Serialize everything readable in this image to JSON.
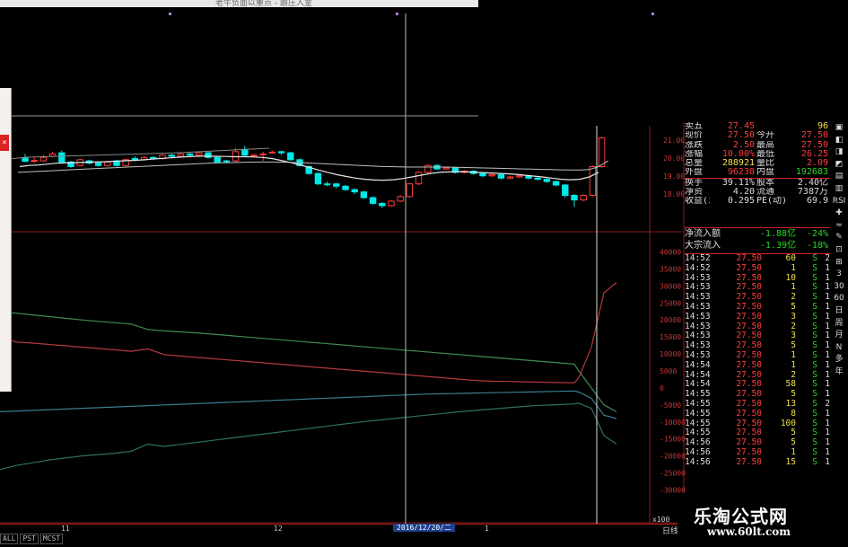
{
  "window": {
    "title": "老牛负面以重点 - 跟庄入室"
  },
  "chart_data": [
    {
      "type": "candlestick",
      "name": "price",
      "y_ticks": [
        "21.00",
        "20.00",
        "19.00",
        "18.00"
      ],
      "candles": [
        {
          "o": 19.92,
          "c": 19.78,
          "h": 20.1,
          "l": 19.75
        },
        {
          "o": 19.78,
          "c": 19.82,
          "h": 19.95,
          "l": 19.7
        },
        {
          "o": 19.8,
          "c": 19.95,
          "h": 20.05,
          "l": 19.75
        },
        {
          "o": 20.0,
          "c": 20.1,
          "h": 20.2,
          "l": 19.95
        },
        {
          "o": 20.15,
          "c": 19.75,
          "h": 20.25,
          "l": 19.7
        },
        {
          "o": 19.75,
          "c": 19.55,
          "h": 19.8,
          "l": 19.5
        },
        {
          "o": 19.6,
          "c": 19.85,
          "h": 19.9,
          "l": 19.55
        },
        {
          "o": 19.8,
          "c": 19.7,
          "h": 19.85,
          "l": 19.65
        },
        {
          "o": 19.7,
          "c": 19.6,
          "h": 19.75,
          "l": 19.55
        },
        {
          "o": 19.6,
          "c": 19.75,
          "h": 19.8,
          "l": 19.55
        },
        {
          "o": 19.8,
          "c": 19.6,
          "h": 19.85,
          "l": 19.55
        },
        {
          "o": 19.6,
          "c": 19.85,
          "h": 19.9,
          "l": 19.55
        },
        {
          "o": 19.9,
          "c": 19.82,
          "h": 20.0,
          "l": 19.78
        },
        {
          "o": 19.85,
          "c": 19.95,
          "h": 20.0,
          "l": 19.8
        },
        {
          "o": 19.95,
          "c": 19.9,
          "h": 20.0,
          "l": 19.85
        },
        {
          "o": 19.9,
          "c": 20.05,
          "h": 20.1,
          "l": 19.85
        },
        {
          "o": 20.05,
          "c": 20.0,
          "h": 20.1,
          "l": 19.95
        },
        {
          "o": 20.0,
          "c": 20.1,
          "h": 20.15,
          "l": 19.95
        },
        {
          "o": 20.1,
          "c": 20.05,
          "h": 20.15,
          "l": 20.0
        },
        {
          "o": 20.05,
          "c": 20.15,
          "h": 20.2,
          "l": 20.0
        },
        {
          "o": 20.15,
          "c": 19.95,
          "h": 20.2,
          "l": 19.9
        },
        {
          "o": 19.95,
          "c": 19.75,
          "h": 20.0,
          "l": 19.7
        },
        {
          "o": 19.8,
          "c": 19.78,
          "h": 19.85,
          "l": 19.7
        },
        {
          "o": 19.8,
          "c": 20.2,
          "h": 20.35,
          "l": 19.75
        },
        {
          "o": 20.3,
          "c": 20.05,
          "h": 20.45,
          "l": 20.0
        },
        {
          "o": 20.05,
          "c": 20.05,
          "h": 20.1,
          "l": 19.95
        },
        {
          "o": 20.1,
          "c": 20.1,
          "h": 20.2,
          "l": 19.8
        },
        {
          "o": 20.15,
          "c": 20.18,
          "h": 20.25,
          "l": 20.1
        },
        {
          "o": 20.2,
          "c": 20.15,
          "h": 20.25,
          "l": 20.05
        },
        {
          "o": 20.15,
          "c": 19.85,
          "h": 20.2,
          "l": 19.8
        },
        {
          "o": 19.85,
          "c": 19.6,
          "h": 19.9,
          "l": 19.55
        },
        {
          "o": 19.55,
          "c": 19.25,
          "h": 19.6,
          "l": 19.2
        },
        {
          "o": 19.25,
          "c": 18.8,
          "h": 19.3,
          "l": 18.75
        },
        {
          "o": 18.8,
          "c": 18.78,
          "h": 18.9,
          "l": 18.7
        },
        {
          "o": 18.8,
          "c": 18.7,
          "h": 18.85,
          "l": 18.6
        },
        {
          "o": 18.7,
          "c": 18.55,
          "h": 18.75,
          "l": 18.5
        },
        {
          "o": 18.55,
          "c": 18.45,
          "h": 18.6,
          "l": 18.35
        },
        {
          "o": 18.45,
          "c": 18.2,
          "h": 18.5,
          "l": 18.15
        },
        {
          "o": 18.2,
          "c": 17.95,
          "h": 18.25,
          "l": 17.9
        },
        {
          "o": 17.95,
          "c": 17.85,
          "h": 18.0,
          "l": 17.75
        },
        {
          "o": 17.85,
          "c": 18.05,
          "h": 18.1,
          "l": 17.8
        },
        {
          "o": 18.05,
          "c": 18.25,
          "h": 18.3,
          "l": 18.0
        },
        {
          "o": 18.25,
          "c": 18.8,
          "h": 18.85,
          "l": 18.2
        },
        {
          "o": 18.8,
          "c": 19.3,
          "h": 19.35,
          "l": 18.75
        },
        {
          "o": 19.3,
          "c": 19.6,
          "h": 19.65,
          "l": 19.25
        },
        {
          "o": 19.6,
          "c": 19.45,
          "h": 19.65,
          "l": 19.4
        },
        {
          "o": 19.45,
          "c": 19.5,
          "h": 19.55,
          "l": 19.4
        },
        {
          "o": 19.5,
          "c": 19.3,
          "h": 19.55,
          "l": 19.25
        },
        {
          "o": 19.3,
          "c": 19.35,
          "h": 19.4,
          "l": 19.25
        },
        {
          "o": 19.35,
          "c": 19.25,
          "h": 19.4,
          "l": 19.2
        },
        {
          "o": 19.25,
          "c": 19.15,
          "h": 19.3,
          "l": 19.1
        },
        {
          "o": 19.15,
          "c": 19.2,
          "h": 19.3,
          "l": 19.1
        },
        {
          "o": 19.2,
          "c": 19.05,
          "h": 19.25,
          "l": 19.0
        },
        {
          "o": 19.05,
          "c": 19.1,
          "h": 19.15,
          "l": 19.0
        },
        {
          "o": 19.1,
          "c": 19.15,
          "h": 19.2,
          "l": 19.05
        },
        {
          "o": 19.15,
          "c": 19.05,
          "h": 19.2,
          "l": 19.0
        },
        {
          "o": 19.05,
          "c": 19.0,
          "h": 19.1,
          "l": 18.95
        },
        {
          "o": 19.0,
          "c": 18.9,
          "h": 19.05,
          "l": 18.85
        },
        {
          "o": 18.9,
          "c": 18.75,
          "h": 18.95,
          "l": 18.7
        },
        {
          "o": 18.75,
          "c": 18.3,
          "h": 18.8,
          "l": 18.2
        },
        {
          "o": 18.3,
          "c": 18.1,
          "h": 18.35,
          "l": 17.8
        },
        {
          "o": 18.1,
          "c": 18.3,
          "h": 18.35,
          "l": 18.05
        },
        {
          "o": 18.3,
          "c": 19.55,
          "h": 19.6,
          "l": 18.25
        },
        {
          "o": 19.55,
          "c": 20.8,
          "h": 20.85,
          "l": 19.5
        }
      ],
      "ma_short": [
        19.55,
        19.6,
        19.62,
        19.66,
        19.7,
        19.71,
        19.72,
        19.74,
        19.75,
        19.76,
        19.78,
        19.8,
        19.82,
        19.84,
        19.87,
        19.9,
        19.93,
        19.96,
        19.98,
        20.0,
        20.01,
        20.0,
        19.99,
        19.98,
        19.98,
        19.97,
        19.95,
        19.9,
        19.82,
        19.73,
        19.63,
        19.52,
        19.4,
        19.3,
        19.2,
        19.12,
        19.05,
        19.0,
        18.97,
        18.96,
        18.98,
        19.03,
        19.1,
        19.18,
        19.25,
        19.3,
        19.32,
        19.33,
        19.32,
        19.3,
        19.28,
        19.26,
        19.24,
        19.22,
        19.18,
        19.14,
        19.1,
        19.05,
        19.0,
        18.98,
        19.0,
        19.1,
        19.3
      ],
      "ma_long": [
        19.3,
        19.32,
        19.34,
        19.36,
        19.38,
        19.4,
        19.42,
        19.44,
        19.46,
        19.48,
        19.5,
        19.52,
        19.54,
        19.56,
        19.58,
        19.6,
        19.62,
        19.64,
        19.66,
        19.68,
        19.7,
        19.71,
        19.72,
        19.73,
        19.74,
        19.75,
        19.75,
        19.75,
        19.74,
        19.73,
        19.72,
        19.7,
        19.68,
        19.66,
        19.64,
        19.62,
        19.6,
        19.58,
        19.56,
        19.55,
        19.54,
        19.53,
        19.53,
        19.53,
        19.53,
        19.53,
        19.52,
        19.51,
        19.5,
        19.49,
        19.48,
        19.47,
        19.46,
        19.45,
        19.44,
        19.43,
        19.42,
        19.41,
        19.4,
        19.4,
        19.42,
        19.55,
        19.8
      ]
    },
    {
      "type": "line",
      "name": "capital-flow",
      "y_ticks": [
        "40000",
        "35000",
        "30000",
        "25000",
        "20000",
        "15000",
        "10000",
        "5000",
        "0",
        "-5000",
        "-10000",
        "-15000",
        "-20000",
        "-25000",
        "-30000"
      ],
      "ylim": [
        -32000,
        42000
      ],
      "series": [
        {
          "color": "#3f8e50",
          "values": [
            22500,
            22000,
            21500,
            21000,
            20500,
            20000,
            19600,
            19200,
            18800,
            17200,
            16800,
            16500,
            16200,
            15800,
            15400,
            15000,
            14600,
            14200,
            13800,
            13400,
            13000,
            12600,
            12200,
            11800,
            11400,
            11000,
            10600,
            10200,
            9800,
            9400,
            9000,
            8600,
            8200,
            7800,
            7400,
            7000,
            5000,
            0,
            -5000,
            -7000
          ]
        },
        {
          "color": "#b33a3a",
          "values": [
            15000,
            13500,
            13200,
            12800,
            12400,
            12000,
            11600,
            11200,
            10800,
            11500,
            9800,
            9400,
            9000,
            8600,
            8200,
            7800,
            7400,
            7000,
            6600,
            6200,
            5800,
            5400,
            5000,
            4600,
            4200,
            3800,
            3400,
            3000,
            2600,
            2200,
            2000,
            1900,
            1800,
            1700,
            1600,
            1500,
            3000,
            12000,
            28000,
            31000
          ]
        },
        {
          "color": "#3a7c8f",
          "values": [
            -7000,
            -6800,
            -6600,
            -6400,
            -6200,
            -6000,
            -5800,
            -5600,
            -5400,
            -5200,
            -5000,
            -4800,
            -4600,
            -4400,
            -4200,
            -4000,
            -3800,
            -3600,
            -3400,
            -3200,
            -3000,
            -2800,
            -2600,
            -2400,
            -2200,
            -2000,
            -1800,
            -1700,
            -1600,
            -1500,
            -1400,
            -1300,
            -1200,
            -1100,
            -1000,
            -900,
            -1200,
            -3000,
            -8000,
            -9000
          ]
        },
        {
          "color": "#2f6f62",
          "values": [
            -24000,
            -22800,
            -22000,
            -21200,
            -20600,
            -20000,
            -19600,
            -19200,
            -18600,
            -16500,
            -17200,
            -16600,
            -16000,
            -15400,
            -14800,
            -14200,
            -13600,
            -13000,
            -12400,
            -11800,
            -11200,
            -10600,
            -10000,
            -9500,
            -9000,
            -8500,
            -8000,
            -7500,
            -7000,
            -6600,
            -6200,
            -5800,
            -5400,
            -5100,
            -4900,
            -4700,
            -4500,
            -6000,
            -14000,
            -16500
          ]
        }
      ]
    }
  ],
  "quote": {
    "rows": [
      {
        "l1": "卖五",
        "v1": "27.45",
        "l2": "",
        "v2": "96",
        "c1": "up",
        "c2": "yl"
      },
      {
        "l1": "现价",
        "v1": "27.50",
        "l2": "今开",
        "v2": "27.50",
        "c1": "up",
        "c2": "up"
      },
      {
        "l1": "涨跌",
        "v1": "2.50",
        "l2": "最高",
        "v2": "27.50",
        "c1": "up",
        "c2": "up"
      },
      {
        "l1": "涨幅",
        "v1": "10.00%",
        "l2": "最低",
        "v2": "26.25",
        "c1": "up",
        "c2": "up"
      },
      {
        "l1": "总量",
        "v1": "288921",
        "l2": "量比",
        "v2": "2.09",
        "c1": "yl",
        "c2": "up"
      },
      {
        "l1": "外盘",
        "v1": "96238",
        "l2": "内盘",
        "v2": "192683",
        "c1": "up",
        "c2": "dn"
      },
      {
        "l1": "换手",
        "v1": "39.11%",
        "l2": "股本",
        "v2": "2.40亿",
        "c1": "wh",
        "c2": "wh"
      },
      {
        "l1": "净资",
        "v1": "4.20",
        "l2": "流通",
        "v2": "7387万",
        "c1": "wh",
        "c2": "wh"
      },
      {
        "l1": "收益(ı)",
        "v1": "0.295",
        "l2": "PE(动)",
        "v2": "69.9",
        "c1": "wh",
        "c2": "wh"
      }
    ]
  },
  "flow": {
    "rows": [
      {
        "label": "净流入额",
        "value": "-1.88亿",
        "pct": "-24%"
      },
      {
        "label": "大宗流入",
        "value": "-1.39亿",
        "pct": "-18%"
      }
    ]
  },
  "ticks": {
    "rows": [
      {
        "t": "14:52",
        "p": "27.50",
        "v": "60",
        "s": "S",
        "n": "2"
      },
      {
        "t": "14:52",
        "p": "27.50",
        "v": "1",
        "s": "S",
        "n": "1"
      },
      {
        "t": "14:53",
        "p": "27.50",
        "v": "10",
        "s": "S",
        "n": "1"
      },
      {
        "t": "14:53",
        "p": "27.50",
        "v": "1",
        "s": "S",
        "n": "1"
      },
      {
        "t": "14:53",
        "p": "27.50",
        "v": "2",
        "s": "S",
        "n": "1"
      },
      {
        "t": "14:53",
        "p": "27.50",
        "v": "5",
        "s": "S",
        "n": "1"
      },
      {
        "t": "14:53",
        "p": "27.50",
        "v": "3",
        "s": "S",
        "n": "1"
      },
      {
        "t": "14:53",
        "p": "27.50",
        "v": "2",
        "s": "S",
        "n": "1"
      },
      {
        "t": "14:53",
        "p": "27.50",
        "v": "3",
        "s": "S",
        "n": "1"
      },
      {
        "t": "14:53",
        "p": "27.50",
        "v": "5",
        "s": "S",
        "n": "1"
      },
      {
        "t": "14:53",
        "p": "27.50",
        "v": "1",
        "s": "S",
        "n": "1"
      },
      {
        "t": "14:54",
        "p": "27.50",
        "v": "1",
        "s": "S",
        "n": "1"
      },
      {
        "t": "14:54",
        "p": "27.50",
        "v": "2",
        "s": "S",
        "n": "1"
      },
      {
        "t": "14:54",
        "p": "27.50",
        "v": "58",
        "s": "S",
        "n": "1"
      },
      {
        "t": "14:55",
        "p": "27.50",
        "v": "5",
        "s": "S",
        "n": "1"
      },
      {
        "t": "14:55",
        "p": "27.50",
        "v": "13",
        "s": "S",
        "n": "2"
      },
      {
        "t": "14:55",
        "p": "27.50",
        "v": "8",
        "s": "S",
        "n": "1"
      },
      {
        "t": "14:55",
        "p": "27.50",
        "v": "100",
        "s": "S",
        "n": "1"
      },
      {
        "t": "14:55",
        "p": "27.50",
        "v": "5",
        "s": "S",
        "n": "1"
      },
      {
        "t": "14:56",
        "p": "27.50",
        "v": "5",
        "s": "S",
        "n": "1"
      },
      {
        "t": "14:56",
        "p": "27.50",
        "v": "1",
        "s": "S",
        "n": "1"
      },
      {
        "t": "14:56",
        "p": "27.50",
        "v": "15",
        "s": "S",
        "n": "1"
      }
    ]
  },
  "toolbar": {
    "items": [
      "▣",
      "◧",
      "◨",
      "◩",
      "▤",
      "▥",
      "RSI",
      "✚",
      "≈",
      "✎",
      "⊡",
      "⊞",
      "3",
      "30",
      "60",
      "日",
      "周",
      "月",
      "N",
      "多",
      "年"
    ]
  },
  "axis": {
    "labels": [
      "11",
      "12",
      "1"
    ],
    "current_date": "2016/12/20/二",
    "zoom": "x100",
    "period": "日线"
  },
  "bottom_tabs": [
    "ALL",
    "PST",
    "MCST"
  ],
  "watermark": {
    "cn": "乐淘公式网",
    "url": "www.60lt.com"
  },
  "colors": {
    "up": "#ff3c3c",
    "down": "#00e8e8",
    "grid": "#8b1a1a",
    "ma_short": "#e6e6e6",
    "ma_long": "#bdbdbd",
    "crosshair": "#bbbbbb"
  }
}
